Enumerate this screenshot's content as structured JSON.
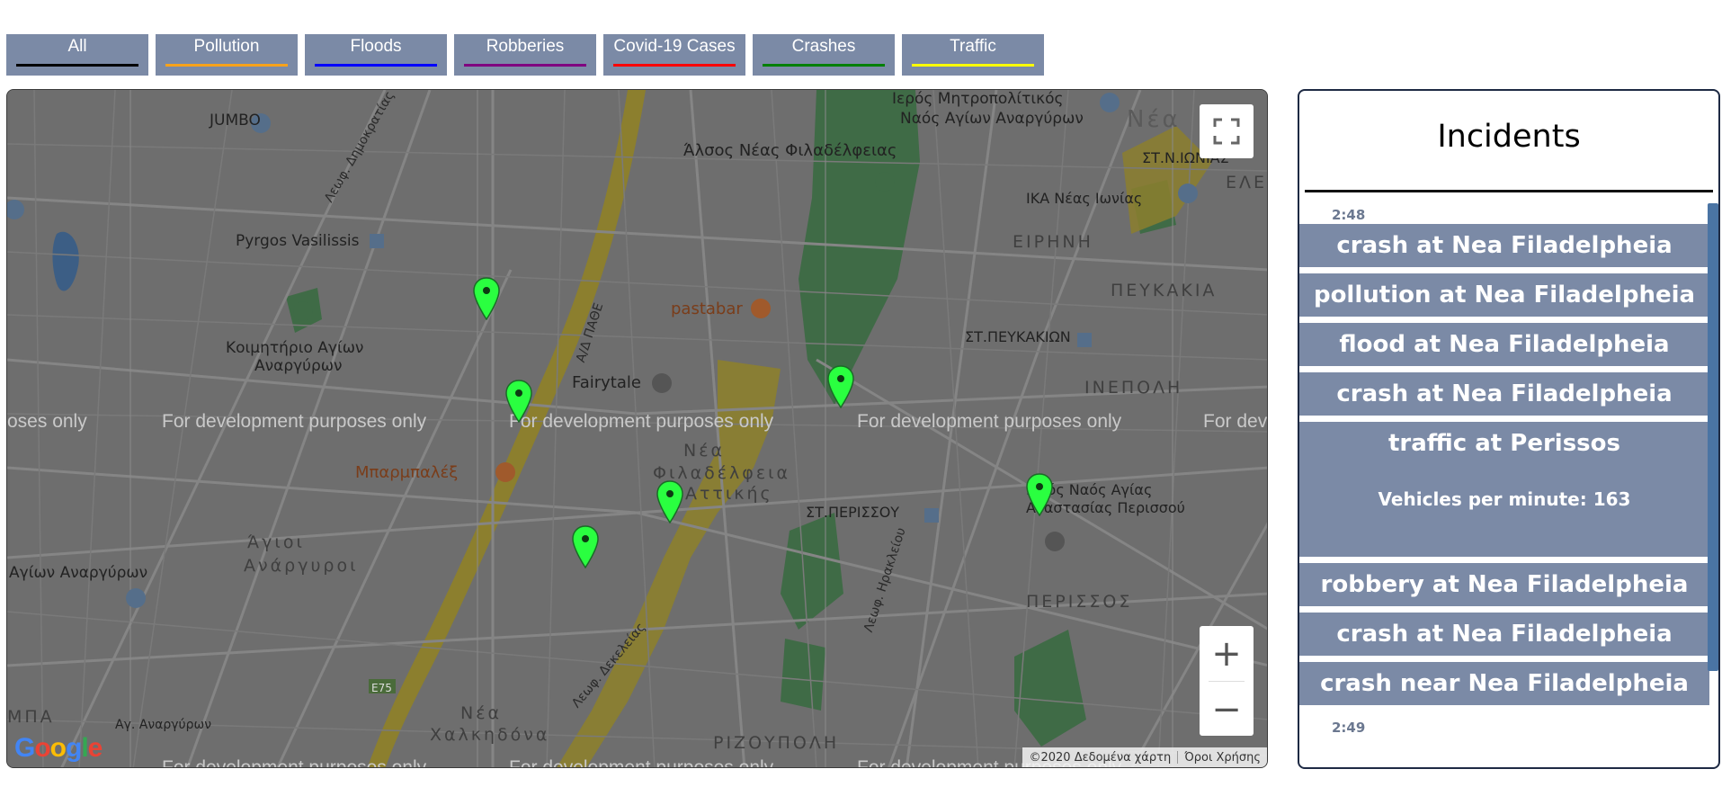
{
  "filters": [
    {
      "label": "All",
      "color": "#000000"
    },
    {
      "label": "Pollution",
      "color": "#f7a21b"
    },
    {
      "label": "Floods",
      "color": "#0000ff"
    },
    {
      "label": "Robberies",
      "color": "#800080"
    },
    {
      "label": "Covid-19 Cases",
      "color": "#ff0000"
    },
    {
      "label": "Crashes",
      "color": "#008000"
    },
    {
      "label": "Traffic",
      "color": "#ffff00"
    }
  ],
  "map": {
    "places": {
      "jumbo": "JUMBO",
      "ieros_naos": "Ιερός Μητροπολίτικός",
      "ieros_naos2": "Ναός Αγίων Αναργύρων",
      "alsos": "Άλσος Νέας Φιλαδέλφειας",
      "pyrgos": "Pyrgos Vasilissis",
      "koimitirio": "Κοιμητήριο Αγίων",
      "koimitirio2": "Αναργύρων",
      "pastabar": "pastabar",
      "fairytale": "Fairytale",
      "mparmpaleks": "Μπαρμπαλέξ",
      "nea_ionias": "ΣΤ.Ν.ΙΩΝΙΑΣ",
      "ika": "ΙΚΑ Νέας Ιωνίας",
      "eirini": "ΕΙΡΗΝΗ",
      "peykakia": "ΠΕΥΚΑΚΙΑ",
      "st_peykakion": "ΣΤ.ΠΕΥΚΑΚΙΩΝ",
      "inepoli": "ΙΝΕΠΟΛΗ",
      "st_perissou": "ΣΤ.ΠΕΡΙΣΣΟΥ",
      "agios_naos": "Ιερός Ναός Αγίας",
      "agios_naos2": "Αναστασίας Περισσού",
      "perissos": "ΠΕΡΙΣΣΟΣ",
      "agioi": "Άγιοι",
      "anargyroi": "Ανάργυροι",
      "nea": "Νέα",
      "filadelfeia": "Φιλαδέλφεια",
      "attikis": "Αττικής",
      "nea2": "Νέα",
      "chalkidona": "Χαλκηδόνα",
      "rizoupoli": "ΡΙΖΟΥΠΟΛΗ",
      "agion_anargyron": "Αγίων Αναργύρων",
      "mpa": "ΜΠΑ",
      "ag_anargyron": "Αγ. Αναργύρων",
      "nea_top": "Νέα",
      "ele": "ΕΛΕ",
      "e75": "E75",
      "ladh": "Λεωφ. Ηρακλείου",
      "dekeleias": "Λεωφ. Δεκελείας",
      "a_a_pathe": "Α/Δ ΠΑΘΕ",
      "dimokratias": "Λεωφ. Δημοκρατίας"
    },
    "dev_text": "For development purposes only",
    "dev_text_partial_left": "oses only",
    "dev_text_partial_right": "For dev",
    "google": "Google",
    "copyright": "©2020 Δεδομένα χάρτη",
    "terms": "Όροι Χρήσης",
    "zoom_in": "+",
    "zoom_out": "−"
  },
  "incidents": {
    "title": "Incidents",
    "time_top": "2:48",
    "time_bottom": "2:49",
    "items": [
      {
        "label": "crash at Nea Filadelpheia"
      },
      {
        "label": "pollution at Nea Filadelpheia"
      },
      {
        "label": "flood at Nea Filadelpheia"
      },
      {
        "label": "crash at Nea Filadelpheia"
      },
      {
        "label": "traffic at Perissos",
        "detail": "Vehicles per minute: 163"
      },
      {
        "label": "robbery at Nea Filadelpheia"
      },
      {
        "label": "crash at Nea Filadelpheia"
      },
      {
        "label": "crash near Nea Filadelpheia"
      }
    ]
  },
  "colors": {
    "accent": "#7b8aa6",
    "pin": "#2aff40",
    "scroll": "#4a74a4"
  },
  "icons": {
    "fullscreen": "fullscreen-icon",
    "pin": "map-pin-icon",
    "poi": "poi-icon"
  }
}
